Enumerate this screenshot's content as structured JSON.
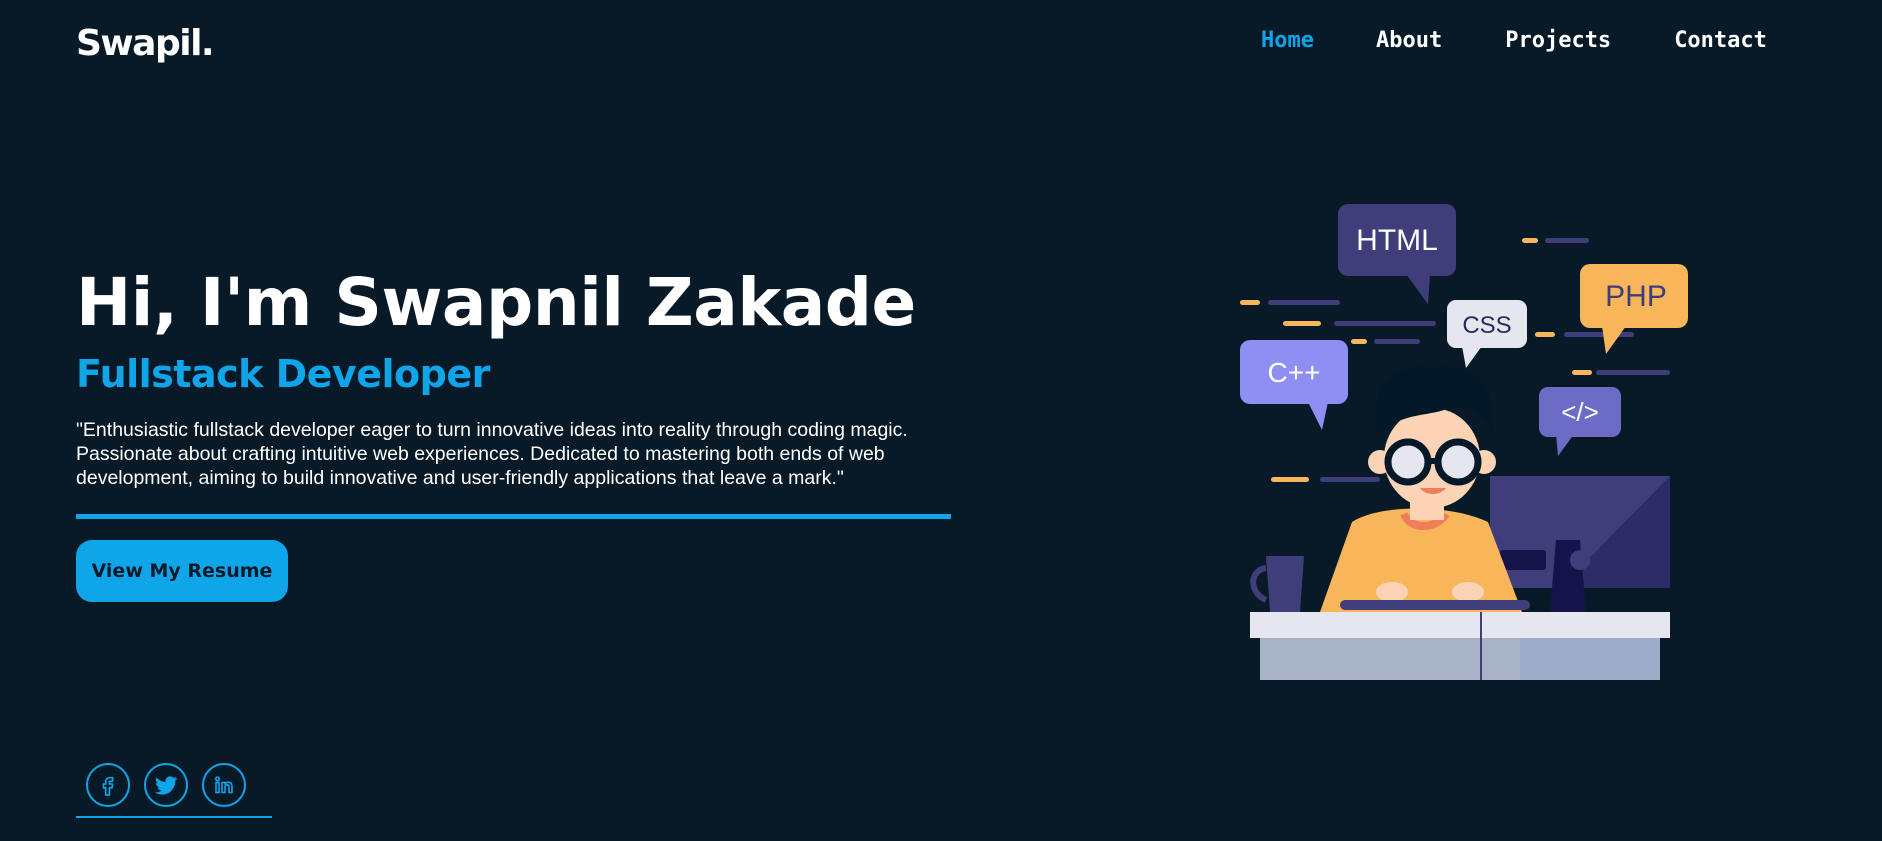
{
  "brand": {
    "logo": "Swapil."
  },
  "nav": {
    "items": [
      {
        "label": "Home",
        "active": true
      },
      {
        "label": "About",
        "active": false
      },
      {
        "label": "Projects",
        "active": false
      },
      {
        "label": "Contact",
        "active": false
      }
    ]
  },
  "hero": {
    "title": "Hi, I'm Swapnil Zakade",
    "subtitle": "Fullstack Developer",
    "description": "\"Enthusiastic fullstack developer eager to turn innovative ideas into reality through coding magic. Passionate about crafting intuitive web experiences. Dedicated to mastering both ends of web development, aiming to build innovative and user-friendly applications that leave a mark.\"",
    "resume_button": "View My Resume"
  },
  "illustration": {
    "bubbles": [
      "HTML",
      "CSS",
      "PHP",
      "C++",
      "</>"
    ]
  },
  "socials": [
    {
      "icon": "facebook-icon"
    },
    {
      "icon": "twitter-icon"
    },
    {
      "icon": "linkedin-icon"
    }
  ],
  "colors": {
    "background": "#081a28",
    "accent": "#0ea5e9",
    "text": "#ffffff"
  }
}
